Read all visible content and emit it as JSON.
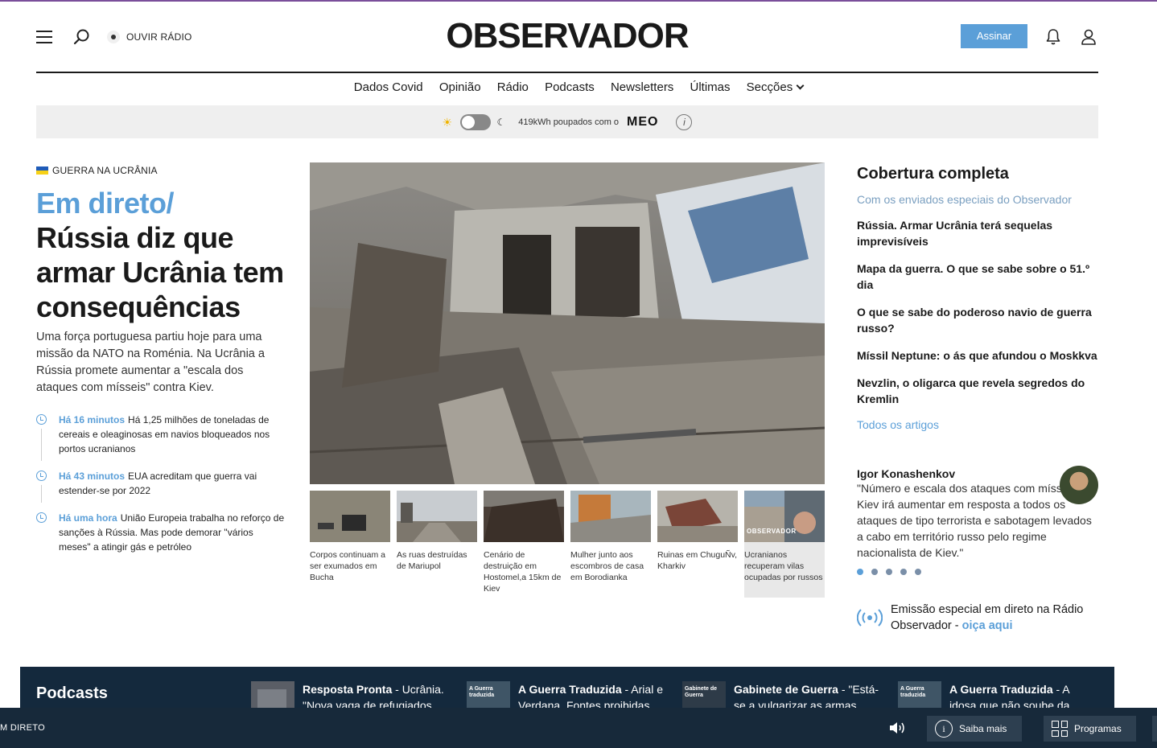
{
  "header": {
    "radio_label": "OUVIR RÁDIO",
    "logo": "OBSERVADOR",
    "subscribe_label": "Assinar"
  },
  "nav": {
    "items": [
      "Dados Covid",
      "Opinião",
      "Rádio",
      "Podcasts",
      "Newsletters",
      "Últimas",
      "Secções"
    ]
  },
  "energy": {
    "text": "419kWh poupados com o",
    "brand": "MEO",
    "info": "i"
  },
  "lead_story": {
    "kicker": "GUERRA NA UCRÂNIA",
    "live_label": "Em direto/",
    "title": "Rússia diz que armar Ucrânia tem consequências",
    "summary": "Uma força portuguesa partiu hoje para uma missão da NATO na Roménia. Na Ucrânia a Rússia promete aumentar a \"escala dos ataques com mísseis\" contra Kiev."
  },
  "timeline": [
    {
      "time": "Há 16 minutos",
      "text": "Há 1,25 milhões de toneladas de cereais e oleaginosas em navios bloqueados nos portos ucranianos"
    },
    {
      "time": "Há 43 minutos",
      "text": "EUA acreditam que guerra vai estender-se por 2022"
    },
    {
      "time": "Há uma hora",
      "text": "União Europeia trabalha no reforço de sanções à Rússia. Mas pode demorar \"vários meses\" a atingir gás e petróleo"
    }
  ],
  "gallery": [
    {
      "caption": "Corpos continuam a ser exumados em Bucha"
    },
    {
      "caption": "As ruas destruídas de Mariupol"
    },
    {
      "caption": "Cenário de destruição em Hostomel,a 15km de Kiev"
    },
    {
      "caption": "Mulher junto aos escombros de casa em Borodianka"
    },
    {
      "caption": "Ruinas em ChuguÑv, Kharkiv"
    },
    {
      "caption": "Ucranianos recuperam vilas ocupadas por russos",
      "overlay": "OBSERVADOR"
    }
  ],
  "coverage": {
    "title": "Cobertura completa",
    "subtitle": "Com os enviados especiais do Observador",
    "items": [
      "Rússia. Armar Ucrânia terá sequelas imprevisíveis",
      "Mapa da guerra. O que se sabe sobre o 51.º dia",
      "O que se sabe do poderoso navio de guerra russo?",
      "Míssil Neptune: o ás que afundou o Moskkva",
      "Nevzlin, o oligarca que revela segredos do Kremlin"
    ],
    "all_label": "Todos os artigos"
  },
  "quote": {
    "name": "Igor Konashenkov",
    "text": "\"Número e escala dos ataques com mísseis em Kiev irá aumentar em resposta a todos os ataques de tipo terrorista e sabotagem levados a cabo em território russo pelo regime nacionalista de Kiev.\"",
    "dots": 5,
    "active_dot": 0
  },
  "emission": {
    "text": "Emissão especial em direto na Rádio Observador - ",
    "link": "oiça aqui"
  },
  "podcasts": {
    "title": "Podcasts",
    "items": [
      {
        "show": "Resposta Pronta",
        "text": " - Ucrânia. \"Nova vaga de refugiados"
      },
      {
        "show": "A Guerra Traduzida",
        "text": " - Arial e Verdana. Fontes proibidas",
        "thumb_label": "A Guerra traduzida"
      },
      {
        "show": "Gabinete de Guerra",
        "text": " - \"Está-se a vulgarizar as armas",
        "thumb_label": "Gabinete de Guerra"
      },
      {
        "show": "A Guerra Traduzida",
        "text": " - A idosa que não soube da",
        "thumb_label": "A Guerra traduzida"
      }
    ]
  },
  "player": {
    "live_label": "M DIRETO",
    "more_label": "Saiba mais",
    "programs_label": "Programas"
  },
  "colors": {
    "accent": "#5b9fd8",
    "dark_navy": "#14293d",
    "top_line": "#7a4e9a"
  }
}
